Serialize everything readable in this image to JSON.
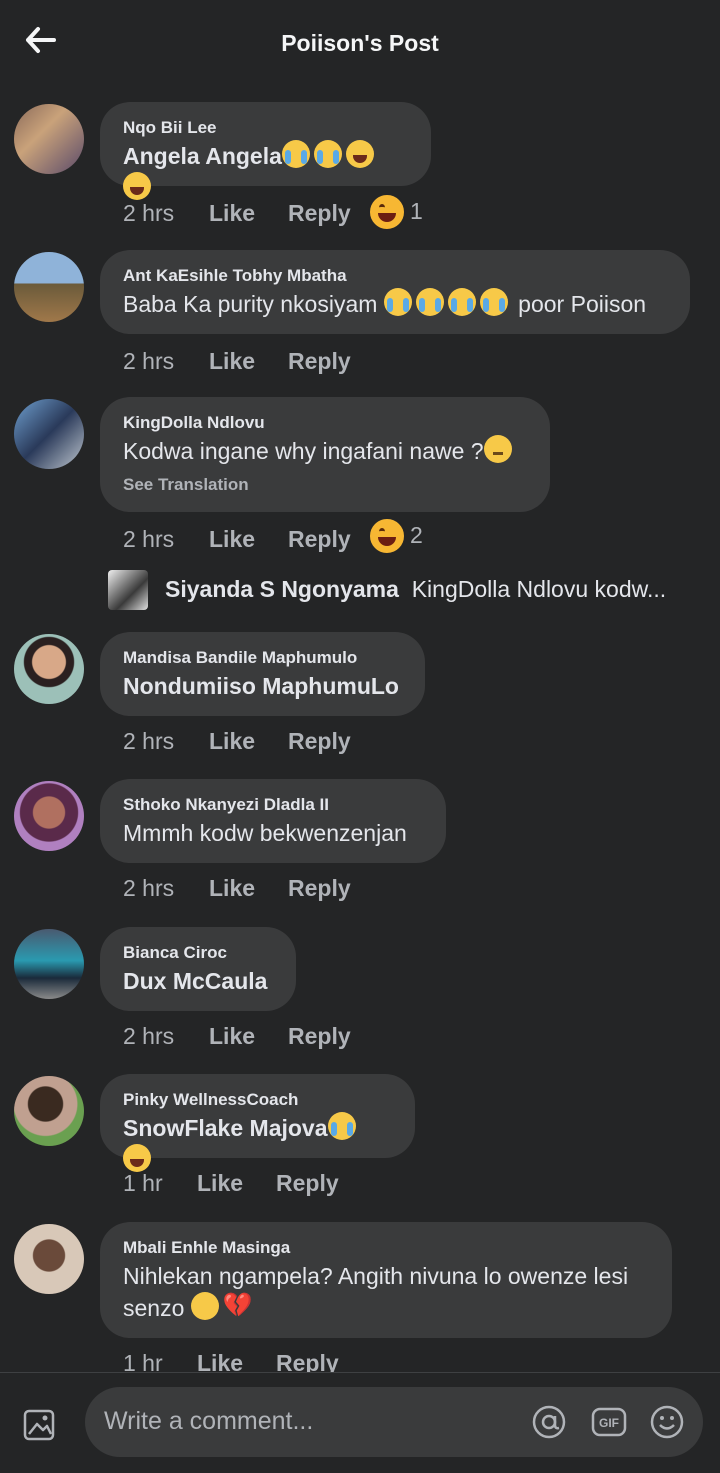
{
  "header": {
    "title": "Poiison's Post"
  },
  "comments": [
    {
      "author": "Nqo Bii Lee",
      "text": "Angela Angela",
      "time": "2 hrs",
      "reaction_count": "1"
    },
    {
      "author": "Ant KaEsihle Tobhy Mbatha",
      "text": "Baba Ka purity  nkosiyam",
      "text_after": " poor Poiison",
      "time": "2 hrs"
    },
    {
      "author": "KingDolla Ndlovu",
      "text": "Kodwa ingane why ingafani nawe ?",
      "see_translation": "See Translation",
      "time": "2 hrs",
      "reaction_count": "2"
    },
    {
      "author": "Mandisa Bandile Maphumulo",
      "text": "Nondumiiso MaphumuLo",
      "time": "2 hrs"
    },
    {
      "author": "Sthoko Nkanyezi Dladla II",
      "text": "Mmmh kodw bekwenzenjan",
      "time": "2 hrs"
    },
    {
      "author": "Bianca Ciroc",
      "text": "Dux McCaula",
      "time": "2 hrs"
    },
    {
      "author": "Pinky WellnessCoach",
      "text": "SnowFlake Majova",
      "time": "1 hr"
    },
    {
      "author": "Mbali Enhle Masinga",
      "text": "Nihlekan ngampela? Angith nivuna lo owenze lesi senzo",
      "time": "1 hr"
    }
  ],
  "actions": {
    "like": "Like",
    "reply": "Reply"
  },
  "reply_preview": {
    "name": "Siyanda S Ngonyama",
    "text": "KingDolla Ndlovu kodw..."
  },
  "composer": {
    "placeholder": "Write a comment..."
  },
  "icons": {
    "back": "arrow-left-icon",
    "photo": "photo-icon",
    "mention": "at-icon",
    "gif": "gif-icon",
    "emoji": "smiley-icon"
  },
  "colors": {
    "background": "#242526",
    "bubble": "#3a3b3c",
    "text": "#e4e6eb",
    "muted": "#b0b3b8"
  }
}
